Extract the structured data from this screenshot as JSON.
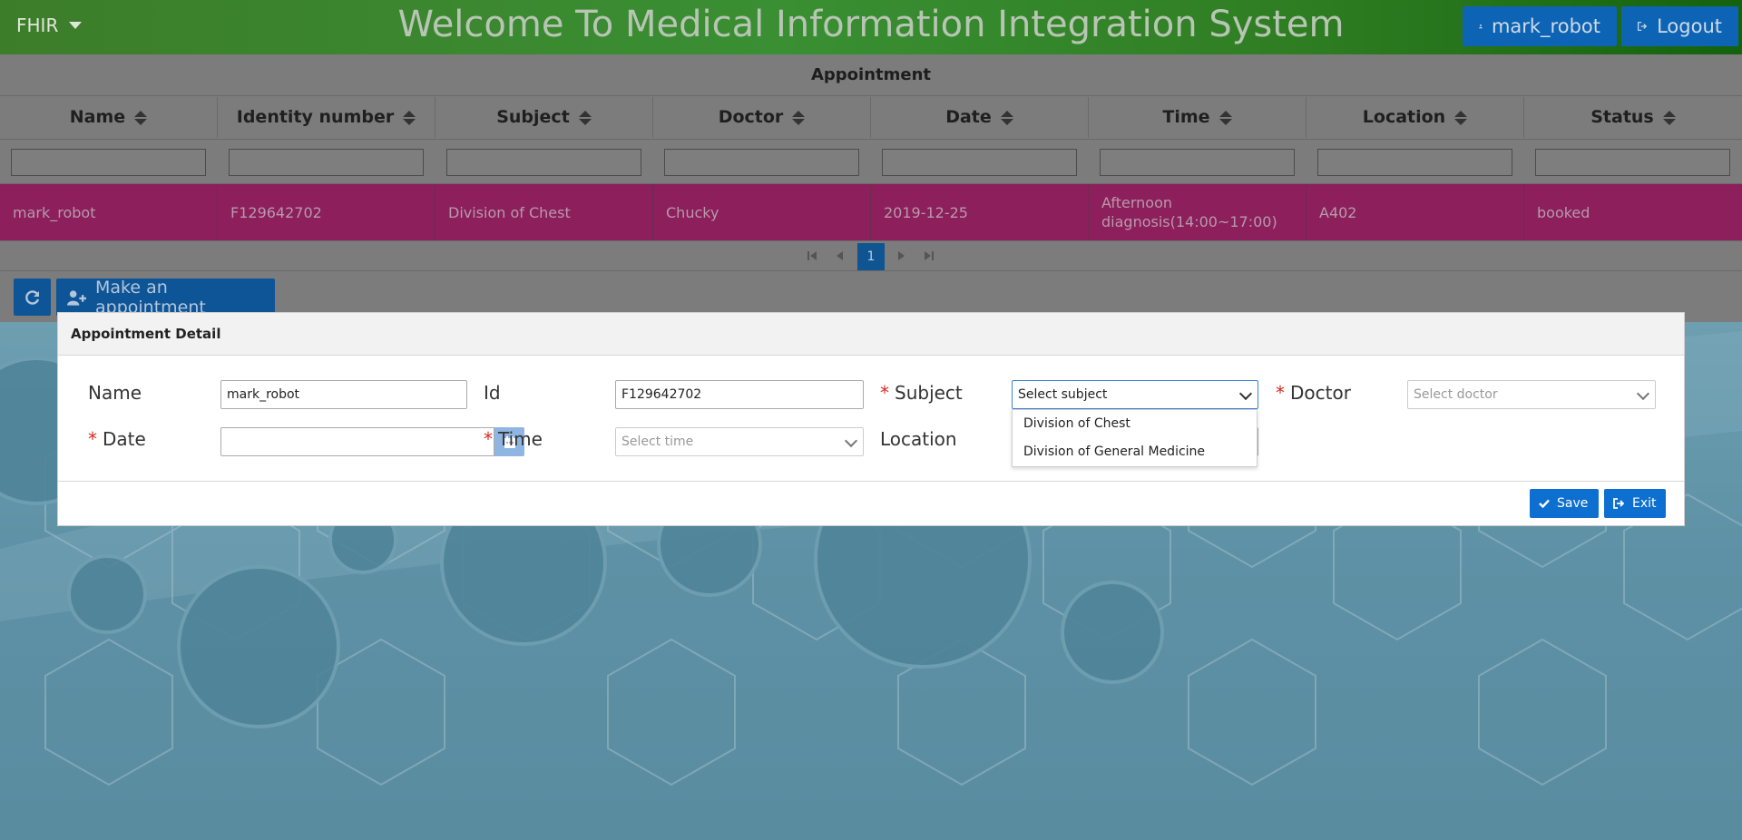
{
  "header": {
    "brand": "FHIR",
    "title": "Welcome To Medical Information Integration System",
    "user_label": "mark_robot",
    "logout_label": "Logout"
  },
  "grid": {
    "caption": "Appointment",
    "columns": [
      "Name",
      "Identity number",
      "Subject",
      "Doctor",
      "Date",
      "Time",
      "Location",
      "Status"
    ],
    "rows": [
      [
        "mark_robot",
        "F129642702",
        "Division of Chest",
        "Chucky",
        "2019-12-25",
        "Afternoon diagnosis(14:00~17:00)",
        "A402",
        "booked"
      ]
    ],
    "page": "1"
  },
  "toolbar": {
    "make_label": "Make an appointment"
  },
  "modal": {
    "title": "Appointment Detail",
    "name_label": "Name",
    "name_value": "mark_robot",
    "id_label": "Id",
    "id_value": "F129642702",
    "subject_label": "Subject",
    "subject_placeholder": "Select subject",
    "doctor_label": "Doctor",
    "doctor_placeholder": "Select doctor",
    "date_label": "Date",
    "time_label": "Time",
    "time_placeholder": "Select time",
    "location_label": "Location",
    "subject_options": [
      "Division of Chest",
      "Division of General Medicine"
    ],
    "save_label": "Save",
    "exit_label": "Exit"
  },
  "colors": {
    "header_green": "#3a8f33",
    "primary_blue": "#0e64b4",
    "selected_row": "#8c1f5c",
    "required": "#d9291c"
  }
}
